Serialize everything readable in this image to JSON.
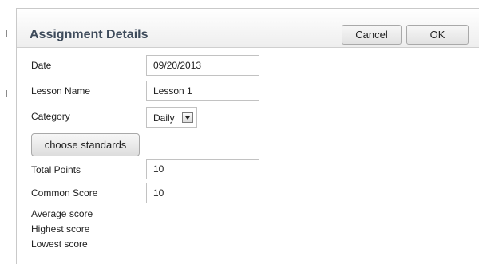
{
  "dialog": {
    "title": "Assignment Details",
    "cancel_label": "Cancel",
    "ok_label": "OK"
  },
  "form": {
    "date": {
      "label": "Date",
      "value": "09/20/2013"
    },
    "lesson_name": {
      "label": "Lesson Name",
      "value": "Lesson 1"
    },
    "category": {
      "label": "Category",
      "selected": "Daily"
    },
    "choose_standards_label": "choose standards",
    "total_points": {
      "label": "Total Points",
      "value": "10"
    },
    "common_score": {
      "label": "Common Score",
      "value": "10"
    }
  },
  "stats": {
    "average_label": "Average score",
    "highest_label": "Highest score",
    "lowest_label": "Lowest score"
  },
  "icons": {
    "category_dropdown": "triangle-down-icon"
  },
  "colors": {
    "title_text": "#3e4b5b",
    "border": "#c2c2c2",
    "button_border": "#a9a9a9"
  }
}
